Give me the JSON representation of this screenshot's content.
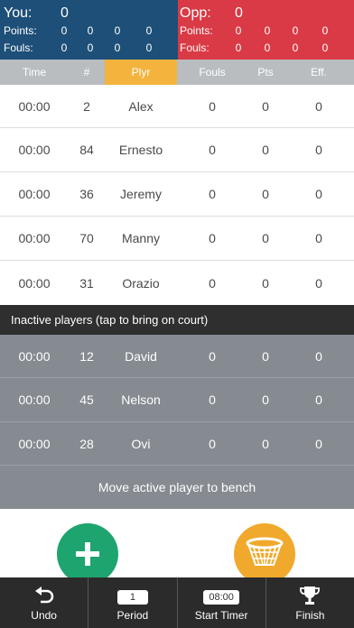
{
  "scoreboard": {
    "you": {
      "label": "You:",
      "score": "0",
      "points_label": "Points:",
      "fouls_label": "Fouls:",
      "points": [
        "0",
        "0",
        "0",
        "0"
      ],
      "fouls": [
        "0",
        "0",
        "0",
        "0"
      ]
    },
    "opp": {
      "label": "Opp:",
      "score": "0",
      "points_label": "Points:",
      "fouls_label": "Fouls:",
      "points": [
        "0",
        "0",
        "0",
        "0"
      ],
      "fouls": [
        "0",
        "0",
        "0",
        "0"
      ]
    },
    "colors": {
      "you": "#1d4f78",
      "opp": "#d93a45"
    }
  },
  "columns": {
    "time": "Time",
    "num": "#",
    "plyr": "Plyr",
    "fouls": "Fouls",
    "pts": "Pts",
    "eff": "Eff."
  },
  "active_players": [
    {
      "time": "00:00",
      "num": "2",
      "name": "Alex",
      "fouls": "0",
      "pts": "0",
      "eff": "0"
    },
    {
      "time": "00:00",
      "num": "84",
      "name": "Ernesto",
      "fouls": "0",
      "pts": "0",
      "eff": "0"
    },
    {
      "time": "00:00",
      "num": "36",
      "name": "Jeremy",
      "fouls": "0",
      "pts": "0",
      "eff": "0"
    },
    {
      "time": "00:00",
      "num": "70",
      "name": "Manny",
      "fouls": "0",
      "pts": "0",
      "eff": "0"
    },
    {
      "time": "00:00",
      "num": "31",
      "name": "Orazio",
      "fouls": "0",
      "pts": "0",
      "eff": "0"
    }
  ],
  "inactive_banner": "Inactive players (tap to bring on court)",
  "inactive_players": [
    {
      "time": "00:00",
      "num": "12",
      "name": "David",
      "fouls": "0",
      "pts": "0",
      "eff": "0"
    },
    {
      "time": "00:00",
      "num": "45",
      "name": "Nelson",
      "fouls": "0",
      "pts": "0",
      "eff": "0"
    },
    {
      "time": "00:00",
      "num": "28",
      "name": "Ovi",
      "fouls": "0",
      "pts": "0",
      "eff": "0"
    }
  ],
  "bench_button": "Move active player to bench",
  "toolbar": {
    "undo": "Undo",
    "period_value": "1",
    "period": "Period",
    "timer_value": "08:00",
    "start_timer": "Start Timer",
    "finish": "Finish"
  },
  "icons": {
    "add": "plus-icon",
    "shot": "basketball-hoop-icon",
    "undo": "undo-icon",
    "finish": "trophy-icon"
  }
}
